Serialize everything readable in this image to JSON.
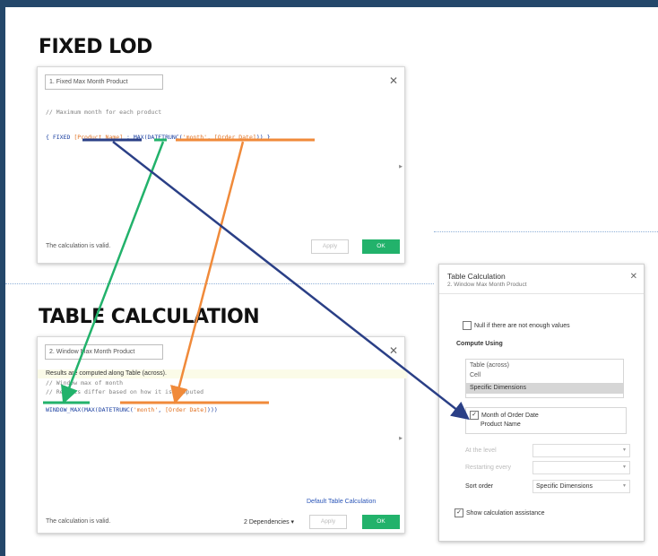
{
  "fixed": {
    "heading": "FIXED LOD",
    "dialog_name": "1. Fixed Max Month Product",
    "comment": "// Maximum month for each product",
    "code": {
      "p1": "{ FIXED ",
      "p2": "[Product Name]",
      "p3": " : ",
      "p4": "MAX",
      "p5": "(DATETRUNC(",
      "p6": "'month'",
      "p7": ", ",
      "p8": "[Order Date]",
      "p9": ")) }"
    },
    "status": "The calculation is valid.",
    "apply_label": "Apply",
    "ok_label": "OK"
  },
  "table": {
    "heading": "TABLE CALCULATION",
    "dialog_name": "2. Window Max Month Product",
    "info": "Results are computed along Table (across).",
    "comment1": "// Window max of month",
    "comment2": "// Results differ based on how it is computed",
    "code": {
      "p1": "WINDOW_MAX(",
      "p2": "MAX",
      "p3": "(DATETRUNC(",
      "p4": "'month'",
      "p5": ", ",
      "p6": "[Order Date]",
      "p7": ")))"
    },
    "default_link": "Default Table Calculation",
    "status": "The calculation is valid.",
    "dependencies": "2 Dependencies ▾",
    "apply_label": "Apply",
    "ok_label": "OK"
  },
  "table_calc": {
    "title": "Table Calculation",
    "subtitle": "2. Window Max Month Product",
    "null_option": "Null if there are not enough values",
    "compute_using": "Compute Using",
    "list": [
      "Table (across)",
      "Cell",
      "Specific Dimensions"
    ],
    "dims": [
      "Month of Order Date",
      "Product Name"
    ],
    "at_level_label": "At the level",
    "restarting_label": "Restarting every",
    "sort_order_label": "Sort order",
    "sort_order_value": "Specific Dimensions",
    "show_assistance": "Show calculation assistance"
  },
  "colors": {
    "navy": "#24476a",
    "green": "#22b26b",
    "orange": "#f08a3a",
    "blue_arrow": "#2a3f86"
  }
}
